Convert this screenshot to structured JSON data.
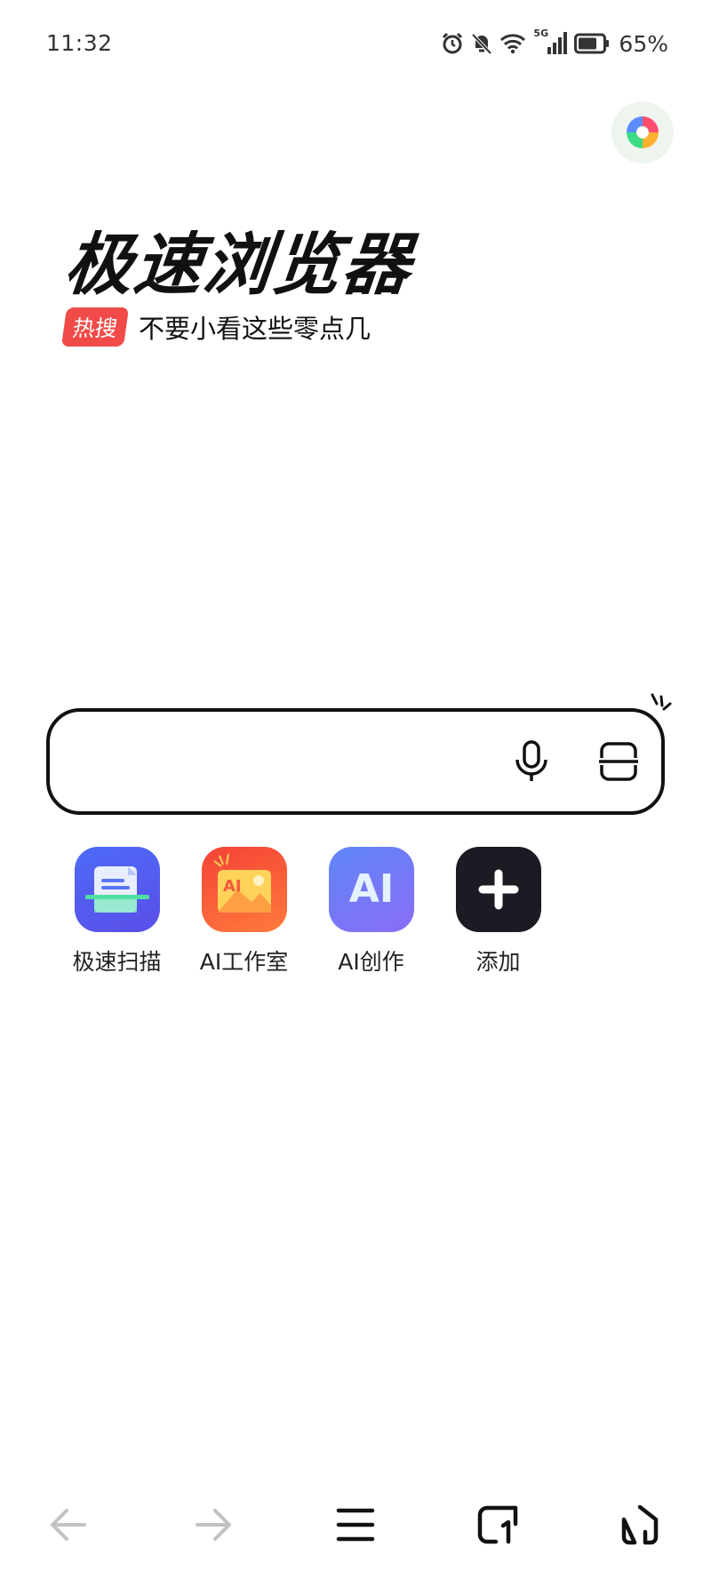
{
  "status_bar": {
    "time": "11:32",
    "network": "5G",
    "battery_percent": "65%"
  },
  "brand": {
    "title": "极速浏览器"
  },
  "hot_search": {
    "badge": "热搜",
    "text": "不要小看这些零点几"
  },
  "search": {
    "placeholder": "",
    "value": ""
  },
  "shortcuts": [
    {
      "label": "极速扫描",
      "icon": "scan-document-icon",
      "color": "#4f5cf5"
    },
    {
      "label": "AI工作室",
      "icon": "ai-studio-icon",
      "color": "#f25a3c"
    },
    {
      "label": "AI创作",
      "icon": "ai-create-icon",
      "color": "#6d7bf7"
    },
    {
      "label": "添加",
      "icon": "plus-icon",
      "color": "#1b1b24"
    }
  ],
  "colors": {
    "accent_hot": "#f04b48",
    "text_primary": "#111111"
  }
}
